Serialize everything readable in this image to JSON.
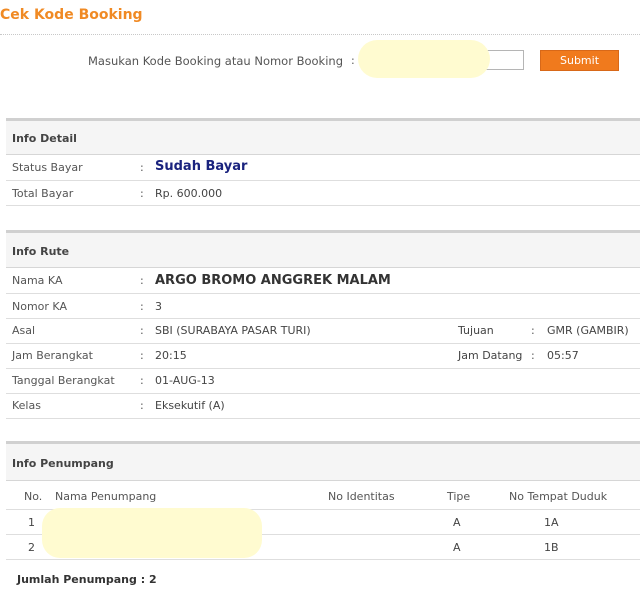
{
  "page": {
    "title": "Cek Kode Booking"
  },
  "search": {
    "label": "Masukan Kode Booking atau Nomor Booking",
    "colon": ":",
    "value": "",
    "submit_label": "Submit"
  },
  "info_detail": {
    "title": "Info Detail",
    "rows": [
      {
        "label": "Status Bayar",
        "value": "Sudah Bayar"
      },
      {
        "label": "Total Bayar",
        "value": "Rp. 600.000"
      }
    ]
  },
  "info_rute": {
    "title": "Info Rute",
    "nama_ka": {
      "label": "Nama KA",
      "value": "ARGO BROMO ANGGREK MALAM"
    },
    "nomor_ka": {
      "label": "Nomor KA",
      "value": "3"
    },
    "asal": {
      "label": "Asal",
      "value": "SBI (SURABAYA PASAR TURI)"
    },
    "tujuan": {
      "label": "Tujuan",
      "value": "GMR (GAMBIR)"
    },
    "jam_berangkat": {
      "label": "Jam Berangkat",
      "value": "20:15"
    },
    "jam_datang": {
      "label": "Jam Datang",
      "value": "05:57"
    },
    "tanggal_berangkat": {
      "label": "Tanggal Berangkat",
      "value": "01-AUG-13"
    },
    "kelas": {
      "label": "Kelas",
      "value": "Eksekutif (A)"
    }
  },
  "info_penumpang": {
    "title": "Info Penumpang",
    "columns": [
      "No.",
      "Nama Penumpang",
      "No Identitas",
      "Tipe",
      "No Tempat Duduk"
    ],
    "rows": [
      {
        "no": "1",
        "nama": "",
        "identitas": "",
        "tipe": "A",
        "kursi": "1A"
      },
      {
        "no": "2",
        "nama": "",
        "identitas": "",
        "tipe": "A",
        "kursi": "1B"
      }
    ],
    "total_label": "Jumlah Penumpang : 2"
  },
  "colors": {
    "accent": "#f08a24",
    "submit_bg": "#f07a1d",
    "status_paid": "#1a237e",
    "section_bg": "#f5f5f5",
    "redaction": "#fffbd0"
  }
}
